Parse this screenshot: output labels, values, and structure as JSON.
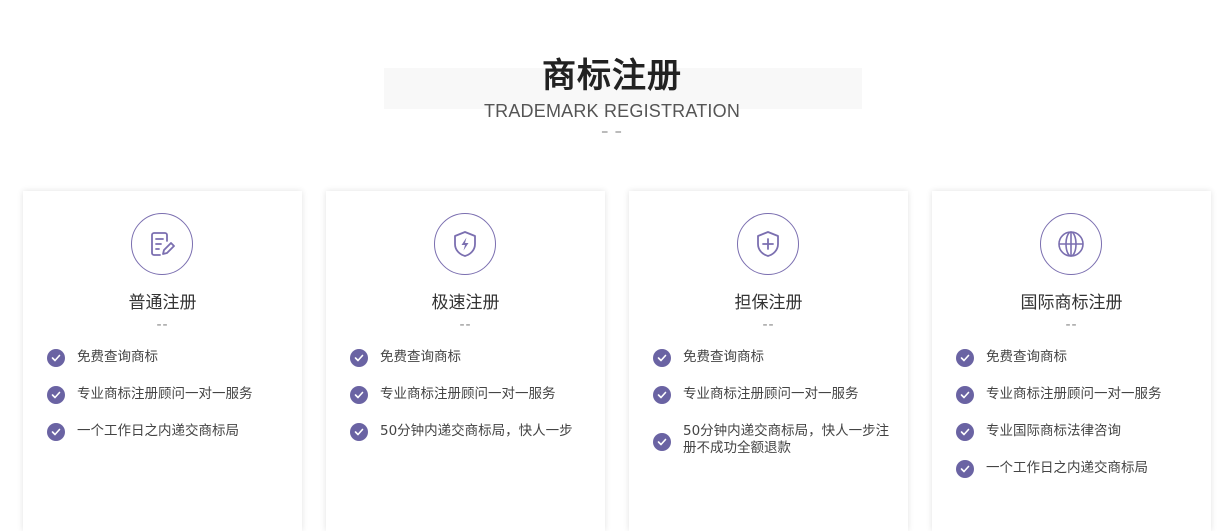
{
  "header": {
    "title": "商标注册",
    "subtitle": "TRADEMARK REGISTRATION",
    "divider": "– –"
  },
  "colors": {
    "accent": "#6a63a3",
    "icon_stroke": "#7b6fb0"
  },
  "cards": [
    {
      "icon": "edit-document-icon",
      "title": "普通注册",
      "dash": "--",
      "features": [
        "免费查询商标",
        "专业商标注册顾问一对一服务",
        "一个工作日之内递交商标局"
      ]
    },
    {
      "icon": "lightning-shield-icon",
      "title": "极速注册",
      "dash": "--",
      "features": [
        "免费查询商标",
        "专业商标注册顾问一对一服务",
        "50分钟内递交商标局，快人一步"
      ]
    },
    {
      "icon": "plus-shield-icon",
      "title": "担保注册",
      "dash": "--",
      "features": [
        "免费查询商标",
        "专业商标注册顾问一对一服务",
        "50分钟内递交商标局，快人一步注册不成功全额退款"
      ]
    },
    {
      "icon": "globe-icon",
      "title": "国际商标注册",
      "dash": "--",
      "features": [
        "免费查询商标",
        "专业商标注册顾问一对一服务",
        "专业国际商标法律咨询",
        "一个工作日之内递交商标局"
      ]
    }
  ]
}
